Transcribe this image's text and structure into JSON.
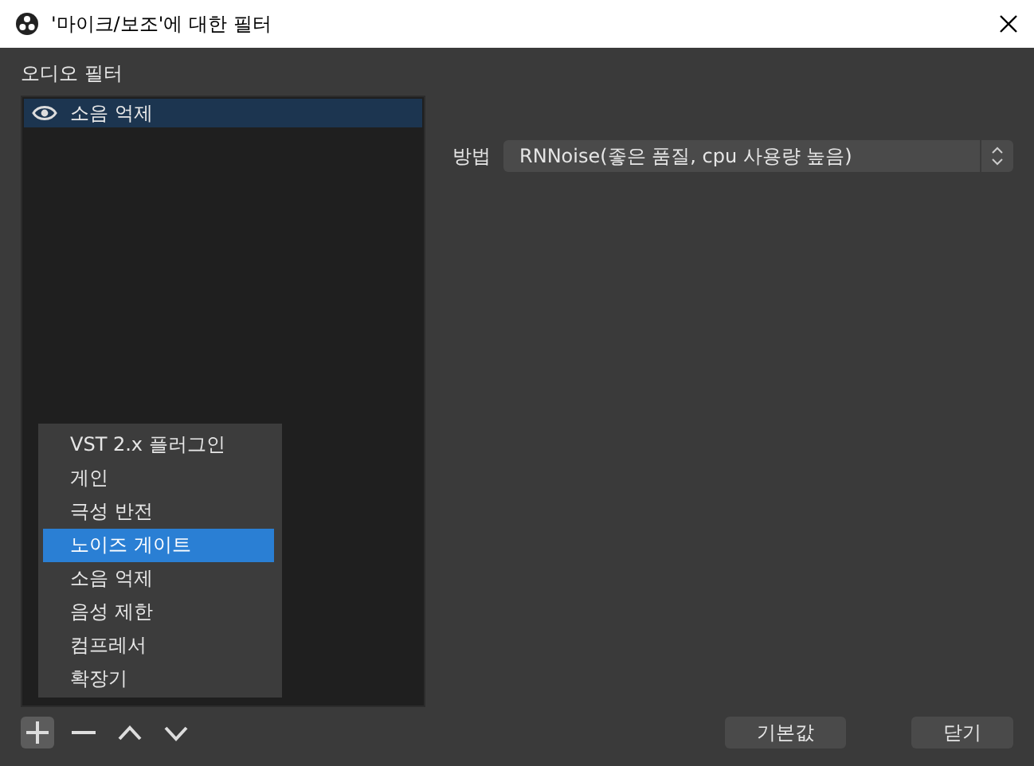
{
  "window": {
    "title": "'마이크/보조'에 대한 필터"
  },
  "filters": {
    "label": "오디오 필터",
    "items": [
      {
        "name": "소음 억제",
        "visible": true,
        "selected": true
      }
    ]
  },
  "properties": {
    "method_label": "방법",
    "method_value": "RNNoise(좋은 품질, cpu 사용량 높음)"
  },
  "add_menu": {
    "items": [
      {
        "label": "VST 2.x 플러그인",
        "selected": false
      },
      {
        "label": "게인",
        "selected": false
      },
      {
        "label": "극성 반전",
        "selected": false
      },
      {
        "label": "노이즈 게이트",
        "selected": true
      },
      {
        "label": "소음 억제",
        "selected": false
      },
      {
        "label": "음성 제한",
        "selected": false
      },
      {
        "label": "컴프레서",
        "selected": false
      },
      {
        "label": "확장기",
        "selected": false
      }
    ]
  },
  "buttons": [
    "기본값",
    "닫기"
  ]
}
